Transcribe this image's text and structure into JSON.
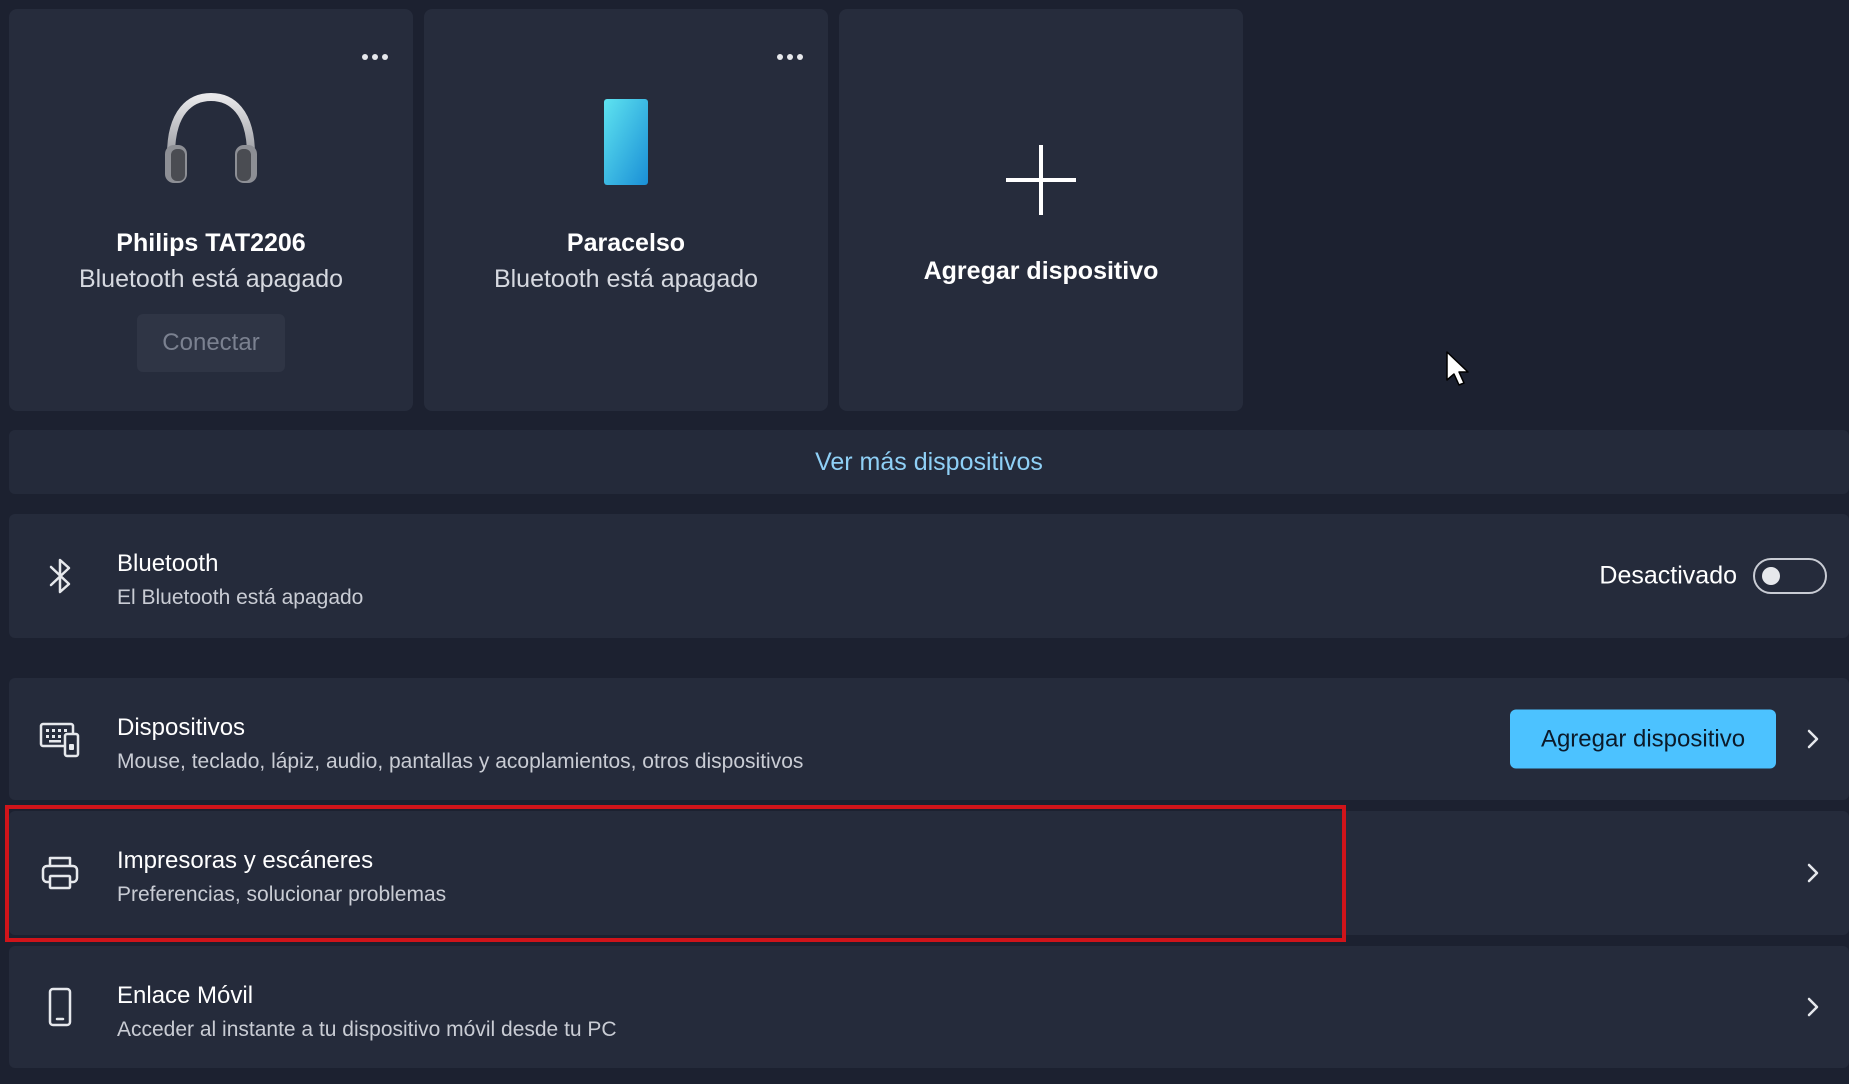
{
  "devices": [
    {
      "name": "Philips TAT2206",
      "status": "Bluetooth está apagado",
      "action": "Conectar",
      "icon": "headphones-icon",
      "menu_icon": "more-icon"
    },
    {
      "name": "Paracelso",
      "status": "Bluetooth está apagado",
      "icon": "phone-icon",
      "menu_icon": "more-icon"
    }
  ],
  "add_card": {
    "label": "Agregar dispositivo",
    "icon": "plus-icon"
  },
  "more_link": "Ver más dispositivos",
  "bluetooth": {
    "title": "Bluetooth",
    "subtitle": "El Bluetooth está apagado",
    "toggle_label": "Desactivado",
    "toggle_on": false,
    "icon": "bluetooth-icon"
  },
  "settings_rows": [
    {
      "title": "Dispositivos",
      "subtitle": "Mouse, teclado, lápiz, audio, pantallas y acoplamientos, otros dispositivos",
      "button": "Agregar dispositivo",
      "icon": "keyboard-device-icon"
    },
    {
      "title": "Impresoras y escáneres",
      "subtitle": "Preferencias, solucionar problemas",
      "icon": "printer-icon",
      "highlighted": true
    },
    {
      "title": "Enlace Móvil",
      "subtitle": "Acceder al instante a tu dispositivo móvil desde tu PC",
      "icon": "mobile-icon"
    }
  ],
  "colors": {
    "background": "#1c2130",
    "card": "#262c3c",
    "accent": "#4cc2ff",
    "link": "#8fd0f6",
    "highlight": "#d0141a"
  }
}
